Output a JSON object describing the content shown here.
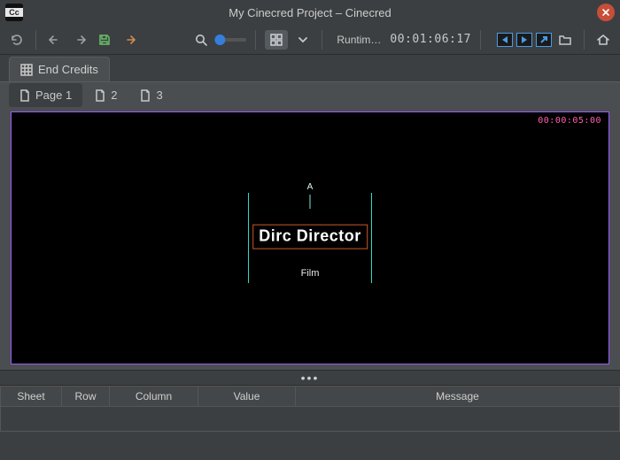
{
  "titlebar": {
    "title": "My Cinecred Project – Cinecred"
  },
  "toolbar": {
    "runtime_label": "Runtim…",
    "timecode": "00:01:06:17"
  },
  "tabs": {
    "credits_label": "End Credits",
    "pages": [
      {
        "label": "Page 1"
      },
      {
        "label": "2"
      },
      {
        "label": "3"
      }
    ]
  },
  "preview": {
    "corner_timecode": "00:00:05:00",
    "axis_label": "A",
    "credit_main": "Dirc Director",
    "credit_sub": "Film"
  },
  "table": {
    "headers": {
      "sheet": "Sheet",
      "row": "Row",
      "column": "Column",
      "value": "Value",
      "message": "Message"
    }
  },
  "colors": {
    "accent": "#357edd",
    "preview_border": "#9a5cff",
    "guide": "#2fd9c8",
    "credit_box": "#cc5a28",
    "tc_pink": "#ff5fb0"
  }
}
